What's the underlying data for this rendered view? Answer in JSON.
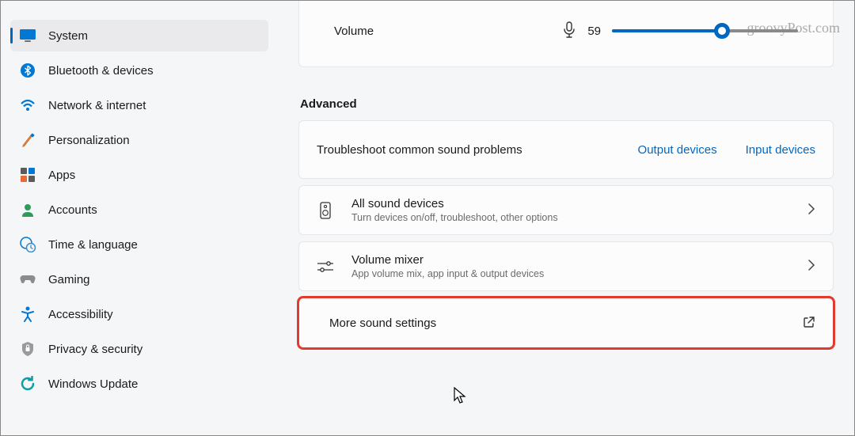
{
  "watermark": "groovyPost.com",
  "sidebar": {
    "items": [
      {
        "label": "System",
        "selected": true
      },
      {
        "label": "Bluetooth & devices"
      },
      {
        "label": "Network & internet"
      },
      {
        "label": "Personalization"
      },
      {
        "label": "Apps"
      },
      {
        "label": "Accounts"
      },
      {
        "label": "Time & language"
      },
      {
        "label": "Gaming"
      },
      {
        "label": "Accessibility"
      },
      {
        "label": "Privacy & security"
      },
      {
        "label": "Windows Update"
      }
    ]
  },
  "volume": {
    "label": "Volume",
    "value": "59",
    "percent": 59
  },
  "advanced": {
    "title": "Advanced",
    "troubleshoot": {
      "label": "Troubleshoot common sound problems",
      "output_link": "Output devices",
      "input_link": "Input devices"
    },
    "all_devices": {
      "title": "All sound devices",
      "subtitle": "Turn devices on/off, troubleshoot, other options"
    },
    "mixer": {
      "title": "Volume mixer",
      "subtitle": "App volume mix, app input & output devices"
    },
    "more": {
      "title": "More sound settings"
    }
  }
}
